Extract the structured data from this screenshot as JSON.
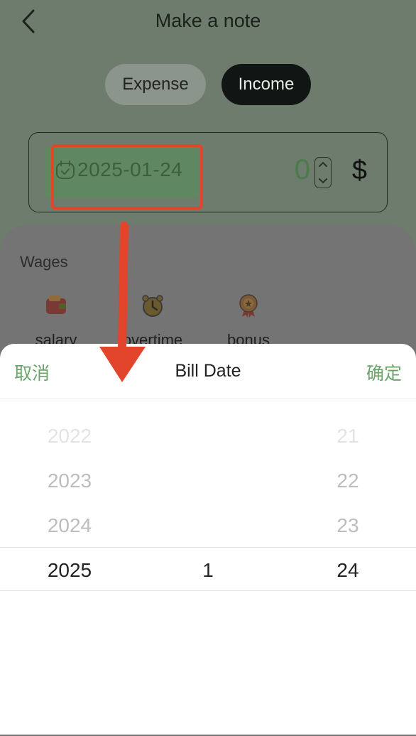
{
  "header": {
    "title": "Make a note"
  },
  "type_toggle": {
    "expense": "Expense",
    "income": "Income"
  },
  "amount_card": {
    "date": "2025-01-24",
    "amount": "0",
    "currency": "$"
  },
  "category_section": {
    "title": "Wages",
    "items": [
      {
        "label": "salary",
        "icon": "wallet-icon"
      },
      {
        "label": "overtime",
        "icon": "clock-icon"
      },
      {
        "label": "bonus",
        "icon": "medal-icon"
      }
    ]
  },
  "picker": {
    "cancel": "取消",
    "title": "Bill Date",
    "confirm": "确定",
    "years": [
      "2022",
      "2023",
      "2024",
      "2025"
    ],
    "month": "1",
    "days": [
      "21",
      "22",
      "23",
      "24"
    ]
  },
  "colors": {
    "accent": "#6aa56a",
    "highlight": "#e2452b"
  }
}
